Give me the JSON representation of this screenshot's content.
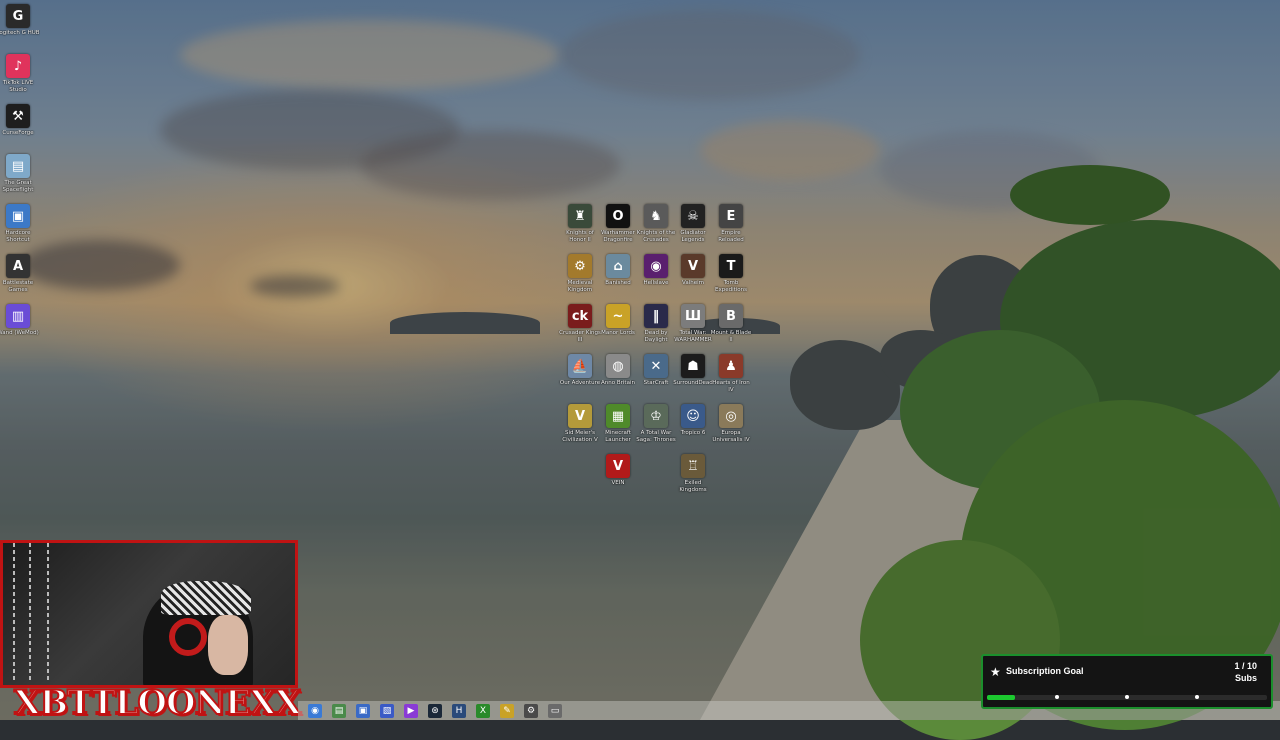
{
  "left_icons": [
    {
      "label": "Logitech G HUB",
      "icon": "logitech-g-icon",
      "color": "#2a2a2a",
      "glyph": "G"
    },
    {
      "label": "TikTok LIVE Studio",
      "icon": "tiktok-icon",
      "color": "#e0335c",
      "glyph": "♪"
    },
    {
      "label": "CurseForge",
      "icon": "curseforge-icon",
      "color": "#1e1e1e",
      "glyph": "⚒"
    },
    {
      "label": "The Great Spaceflight",
      "icon": "file-icon",
      "color": "#7fa9c9",
      "glyph": "▤"
    },
    {
      "label": "Hardcore Shortcut",
      "icon": "shortcut-icon",
      "color": "#3c79c7",
      "glyph": "▣"
    },
    {
      "label": "Battlestate Games",
      "icon": "battlestate-icon",
      "color": "#333333",
      "glyph": "A"
    },
    {
      "label": "Wand (WeMod)",
      "icon": "wand-icon",
      "color": "#6a4cd6",
      "glyph": "▥"
    }
  ],
  "grid_icons": [
    {
      "label": "Knights of Honor II",
      "icon": "game-icon",
      "color": "#3a4a3a",
      "glyph": "♜"
    },
    {
      "label": "Warhammer Dragonfire",
      "icon": "game-icon",
      "color": "#111111",
      "glyph": "O"
    },
    {
      "label": "Knights of the Crusades",
      "icon": "game-icon",
      "color": "#5a5a5a",
      "glyph": "♞"
    },
    {
      "label": "Gladiator Legends",
      "icon": "game-icon",
      "color": "#222222",
      "glyph": "☠"
    },
    {
      "label": "Empire Reloaded",
      "icon": "game-icon",
      "color": "#444444",
      "glyph": "E"
    },
    {
      "label": "Medieval Kingdom",
      "icon": "game-icon",
      "color": "#a37a2c",
      "glyph": "⚙"
    },
    {
      "label": "Banished",
      "icon": "game-icon",
      "color": "#6b8a9e",
      "glyph": "⌂"
    },
    {
      "label": "Hellslave",
      "icon": "game-icon",
      "color": "#5a1f6e",
      "glyph": "◉"
    },
    {
      "label": "Valheim",
      "icon": "game-icon",
      "color": "#5a3a2a",
      "glyph": "V"
    },
    {
      "label": "Tomb Expeditions",
      "icon": "game-icon",
      "color": "#1a1a1a",
      "glyph": "T"
    },
    {
      "label": "Crusader Kings III",
      "icon": "game-icon",
      "color": "#7a1c1c",
      "glyph": "ck"
    },
    {
      "label": "Manor Lords",
      "icon": "game-icon",
      "color": "#c9a227",
      "glyph": "~"
    },
    {
      "label": "Dead by Daylight",
      "icon": "game-icon",
      "color": "#2a2a4a",
      "glyph": "‖"
    },
    {
      "label": "Total War: WARHAMMER",
      "icon": "game-icon",
      "color": "#7c7c7c",
      "glyph": "Ш"
    },
    {
      "label": "Mount & Blade II",
      "icon": "game-icon",
      "color": "#6a6a6a",
      "glyph": "B"
    },
    {
      "label": "Our Adventure",
      "icon": "game-icon",
      "color": "#6e88a6",
      "glyph": "⛵"
    },
    {
      "label": "Anno Britain",
      "icon": "game-icon",
      "color": "#8a8a8a",
      "glyph": "◍"
    },
    {
      "label": "StarCraft",
      "icon": "game-icon",
      "color": "#4a6a8a",
      "glyph": "✕"
    },
    {
      "label": "SurroundDead",
      "icon": "game-icon",
      "color": "#1c1c1c",
      "glyph": "☗"
    },
    {
      "label": "Hearts of Iron IV",
      "icon": "game-icon",
      "color": "#8a3a2a",
      "glyph": "♟"
    },
    {
      "label": "Sid Meier's Civilization V",
      "icon": "game-icon",
      "color": "#b49a3a",
      "glyph": "V"
    },
    {
      "label": "Minecraft Launcher",
      "icon": "minecraft-icon",
      "color": "#4f8a2a",
      "glyph": "▦"
    },
    {
      "label": "A Total War Saga: Thrones",
      "icon": "game-icon",
      "color": "#5a6a5a",
      "glyph": "♔"
    },
    {
      "label": "Tropico 6",
      "icon": "game-icon",
      "color": "#3a5a8a",
      "glyph": "☺"
    },
    {
      "label": "Europa Universalis IV",
      "icon": "game-icon",
      "color": "#8a7a5a",
      "glyph": "◎"
    },
    {
      "label": "VEIN",
      "icon": "vein-icon",
      "color": "#b11a1a",
      "glyph": "V"
    },
    {
      "label": "Exiled Kingdoms",
      "icon": "game-icon",
      "color": "#6a5a3a",
      "glyph": "♖"
    }
  ],
  "streamer_name": "XBTTLOONEXX",
  "taskbar": {
    "items": [
      {
        "icon": "chrome-icon",
        "color": "#3a7ad6",
        "glyph": "◉"
      },
      {
        "icon": "files-icon",
        "color": "#4a8a4a",
        "glyph": "▤"
      },
      {
        "icon": "explorer-icon",
        "color": "#3a6ac6",
        "glyph": "▣"
      },
      {
        "icon": "store-icon",
        "color": "#3a5ac6",
        "glyph": "▧"
      },
      {
        "icon": "twitch-icon",
        "color": "#8a3ad6",
        "glyph": "▶"
      },
      {
        "icon": "steam-icon",
        "color": "#1b2838",
        "glyph": "⊛"
      },
      {
        "icon": "app-icon",
        "color": "#2a4a7a",
        "glyph": "H"
      },
      {
        "icon": "xbox-icon",
        "color": "#2a8a2a",
        "glyph": "X"
      },
      {
        "icon": "notes-icon",
        "color": "#c9a227",
        "glyph": "✎"
      },
      {
        "icon": "settings-icon",
        "color": "#4a4a4a",
        "glyph": "⚙"
      },
      {
        "icon": "monitor-icon",
        "color": "#6a6a6a",
        "glyph": "▭"
      }
    ]
  },
  "subscription_goal": {
    "title": "Subscription Goal",
    "count": "1 / 10",
    "unit": "Subs",
    "progress_fraction": 0.1,
    "bar_color": "#1cc92f",
    "border_color": "#1b8f2c"
  }
}
